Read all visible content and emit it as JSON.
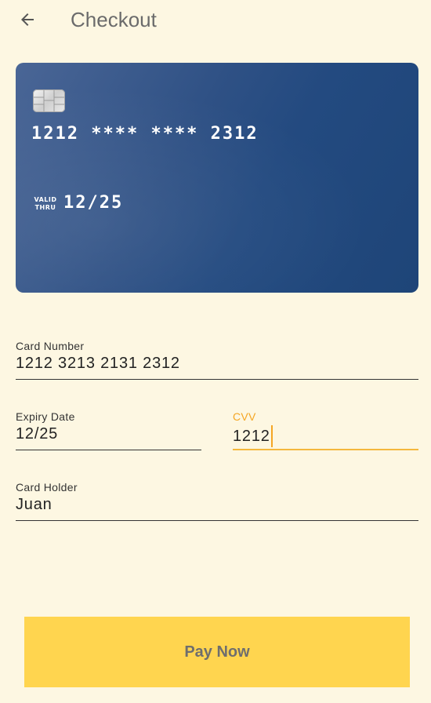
{
  "header": {
    "title": "Checkout",
    "back_icon": "arrow-left-icon"
  },
  "card": {
    "masked_number": "1212 **** **** 2312",
    "valid_line1": "VALID",
    "valid_line2": "THRU",
    "expiry": "12/25",
    "chip_icon": "card-chip-icon",
    "gradient_colors": [
      "#4a6696",
      "#1e4578"
    ]
  },
  "form": {
    "card_number": {
      "label": "Card Number",
      "value": "1212 3213 2131 2312"
    },
    "expiry_date": {
      "label": "Expiry Date",
      "value": "12/25"
    },
    "cvv": {
      "label": "CVV",
      "value": "1212",
      "focused": true
    },
    "card_holder": {
      "label": "Card Holder",
      "value": "Juan"
    }
  },
  "actions": {
    "pay_label": "Pay Now"
  },
  "colors": {
    "background": "#fdf7e2",
    "accent": "#f5a623",
    "button": "#ffd54f"
  }
}
